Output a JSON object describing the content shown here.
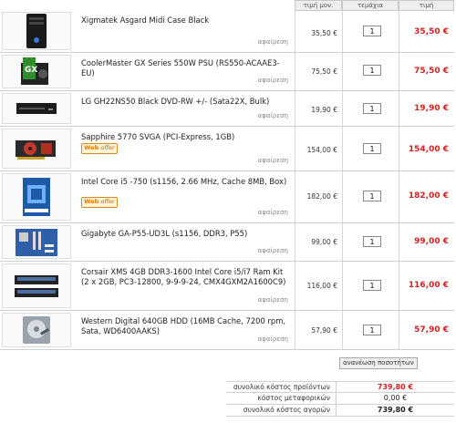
{
  "headers": {
    "unit_price": "τιμή μον.",
    "quantity": "τεμάχια",
    "price": "τιμή"
  },
  "remove_label": "αφαίρεση",
  "web_offer": {
    "word1": "Web",
    "word2": "offer"
  },
  "items": [
    {
      "name": "Xigmatek Asgard Midi Case Black",
      "image": "pc-case-icon",
      "unit_price": "35,50 €",
      "qty": "1",
      "total": "35,50 €",
      "web_offer": false
    },
    {
      "name": "CoolerMaster GX Series 550W PSU (RS550-ACAAE3-EU)",
      "image": "psu-icon",
      "unit_price": "75,50 €",
      "qty": "1",
      "total": "75,50 €",
      "web_offer": false
    },
    {
      "name": "LG GH22NS50 Black DVD-RW +/- (Sata22X, Bulk)",
      "image": "dvd-drive-icon",
      "unit_price": "19,90 €",
      "qty": "1",
      "total": "19,90 €",
      "web_offer": false
    },
    {
      "name": "Sapphire 5770 SVGA (PCI-Express, 1GB)",
      "image": "gpu-icon",
      "unit_price": "154,00 €",
      "qty": "1",
      "total": "154,00 €",
      "web_offer": true
    },
    {
      "name": "Intel Core i5 -750 (s1156, 2.66 MHz, Cache 8MB, Box)",
      "image": "cpu-box-icon",
      "unit_price": "182,00 €",
      "qty": "1",
      "total": "182,00 €",
      "web_offer": true
    },
    {
      "name": "Gigabyte GA-P55-UD3L (s1156, DDR3, P55)",
      "image": "motherboard-icon",
      "unit_price": "99,00 €",
      "qty": "1",
      "total": "99,00 €",
      "web_offer": false
    },
    {
      "name": "Corsair XMS 4GB DDR3-1600 Intel Core i5/i7 Ram Kit (2 x 2GB, PC3-12800, 9-9-9-24, CMX4GXM2A1600C9)",
      "image": "ram-icon",
      "unit_price": "116,00 €",
      "qty": "1",
      "total": "116,00 €",
      "web_offer": false
    },
    {
      "name": "Western Digital 640GB HDD (16MB Cache, 7200 rpm, Sata, WD6400AAKS)",
      "image": "hdd-icon",
      "unit_price": "57,90 €",
      "qty": "1",
      "total": "57,90 €",
      "web_offer": false
    }
  ],
  "update_button": "ανανέωση ποσοτήτων",
  "summary": {
    "products_label": "συνολικό κόστος προϊόντων",
    "products_value": "739,80 €",
    "shipping_label": "κόστος μεταφορικών",
    "shipping_value": "0,00 €",
    "grand_label": "συνολικό κόστος αγορών",
    "grand_value": "739,80 €"
  },
  "colors": {
    "price_red": "#d42121",
    "header_bg": "#eeeeee",
    "border": "#cfcfcf"
  }
}
